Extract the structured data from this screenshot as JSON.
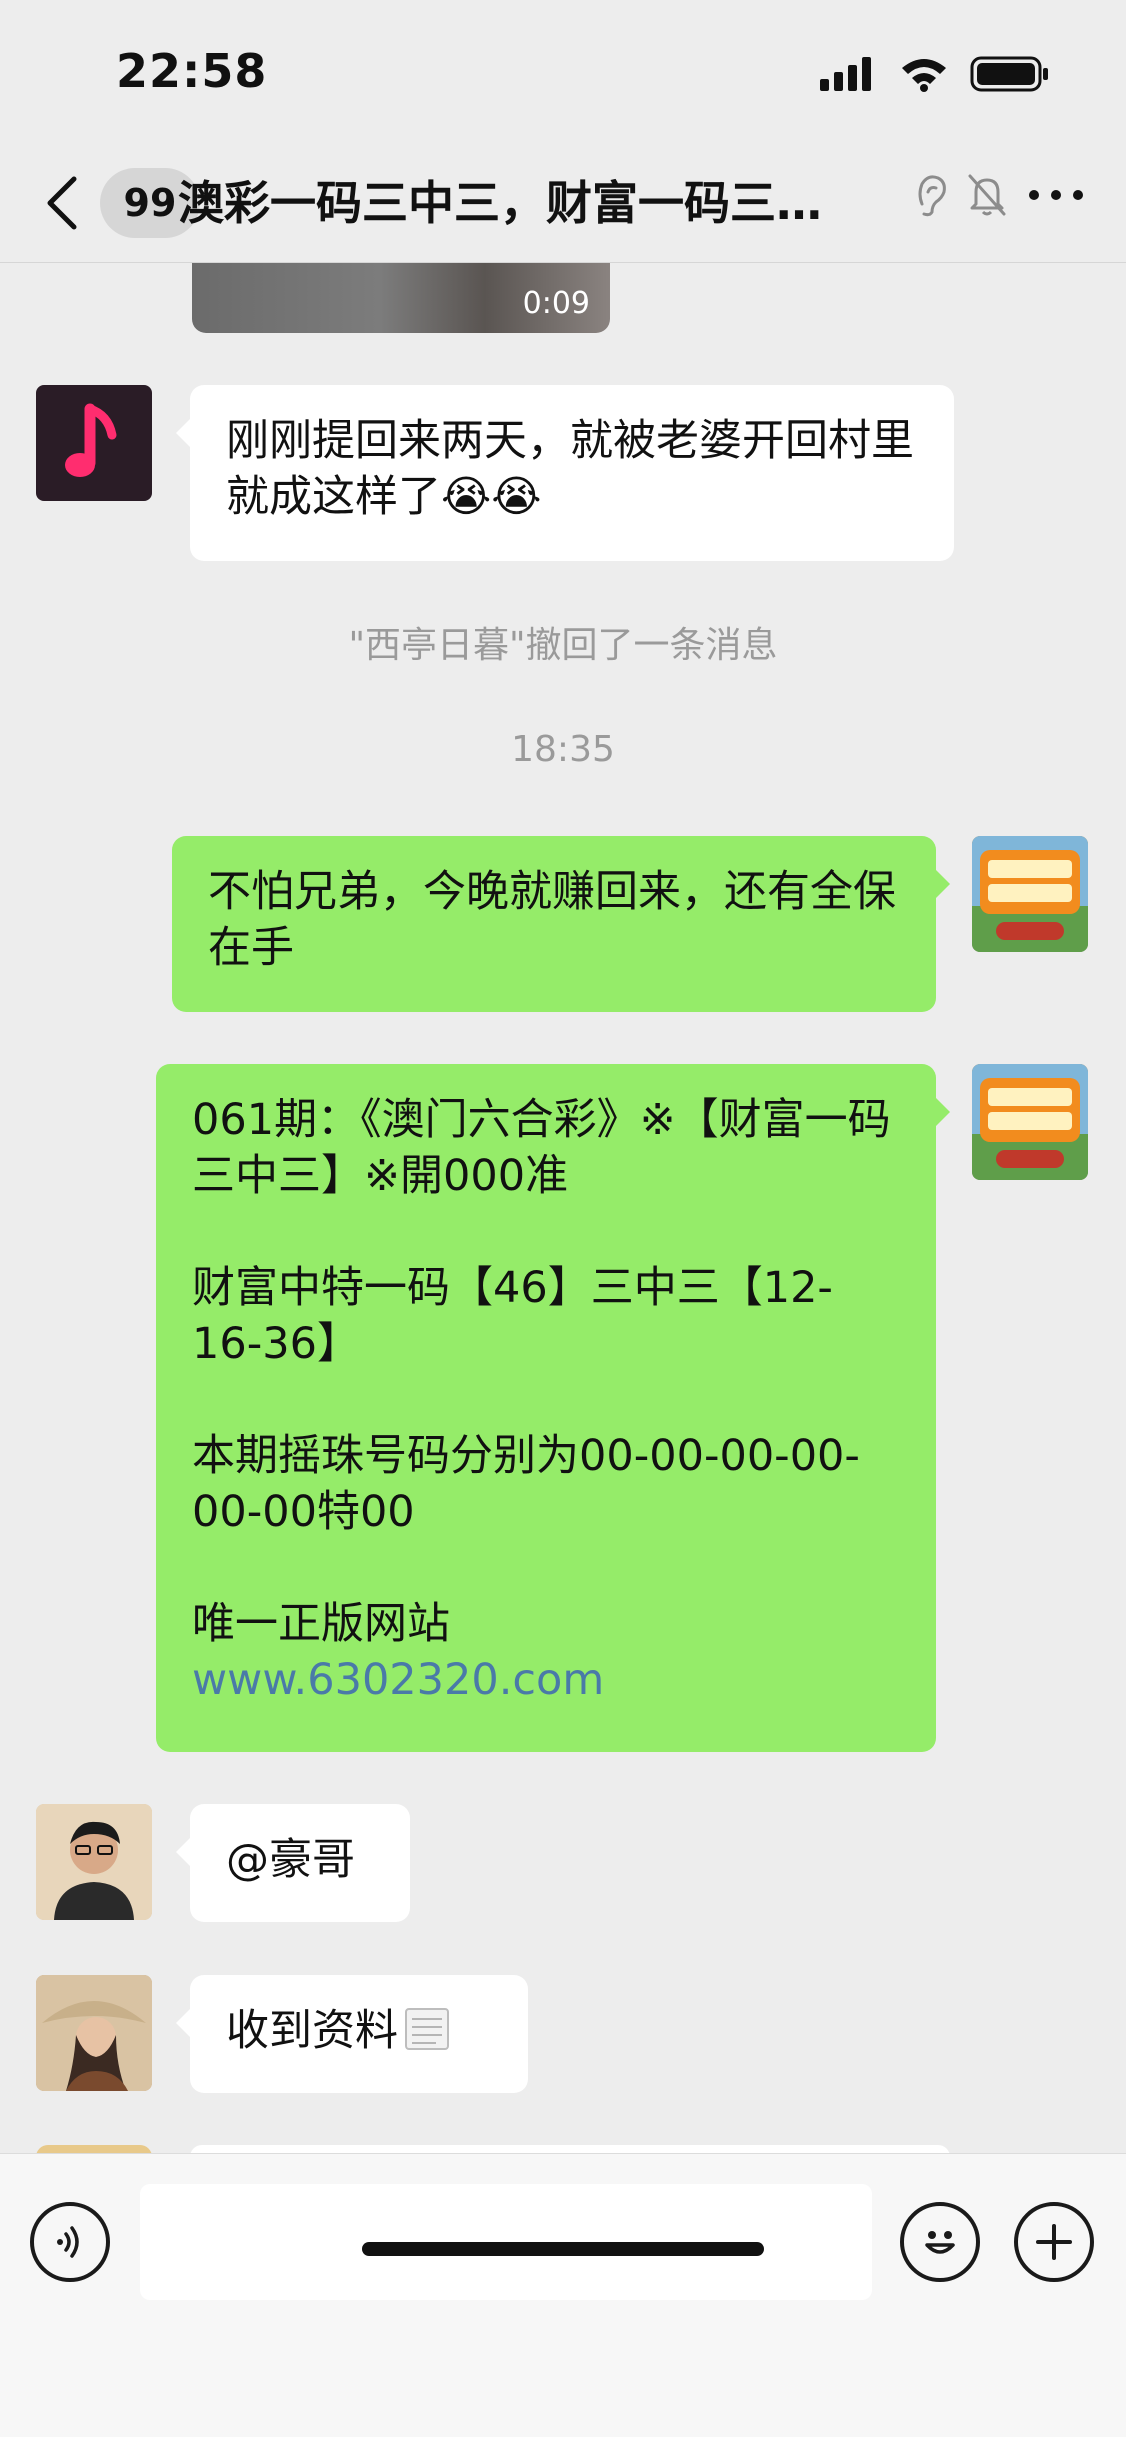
{
  "status_bar": {
    "time": "22:58"
  },
  "header": {
    "unread_count": "99",
    "title": "澳彩一码三中三，财富一码三…",
    "back_icon": "chevron-left-icon",
    "earpiece_icon": "ear-icon",
    "mute_icon": "bell-off-icon",
    "more_icon": "more-dots-icon"
  },
  "chat": {
    "video": {
      "duration": "0:09"
    },
    "messages": [
      {
        "side": "left",
        "avatar": "music-app-avatar",
        "text": "刚刚提回来两天，就被老婆开回村里就成这样了😭😭"
      },
      {
        "type": "system",
        "text": "\"西亭日暮\"撤回了一条消息"
      },
      {
        "type": "time",
        "text": "18:35"
      },
      {
        "side": "right",
        "text": "不怕兄弟，今晚就赚回来，还有全保在手"
      },
      {
        "side": "right",
        "lines": [
          "061期：《澳门六合彩》※【财富一码三中三】※開000准",
          "财富中特一码【46】三中三【12-16-36】",
          "本期摇珠号码分别为00-00-00-00-00-00特00",
          "唯一正版网站"
        ],
        "link": "www.6302320.com"
      },
      {
        "side": "left",
        "text": "@豪哥"
      },
      {
        "side": "left",
        "text": "收到资料",
        "emoji_icon": "scroll-icon"
      }
    ]
  },
  "colors": {
    "background": "#ededed",
    "outgoing_bubble": "#95ec69",
    "incoming_bubble": "#ffffff",
    "link": "#4a7aa8"
  },
  "input_bar": {
    "voice_icon": "voice-icon",
    "emoji_icon": "smiley-icon",
    "add_icon": "plus-icon"
  }
}
